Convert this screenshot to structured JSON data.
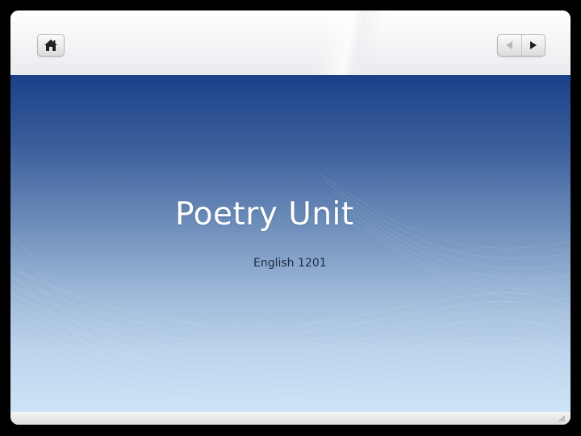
{
  "slide": {
    "title": "Poetry Unit",
    "subtitle": "English 1201"
  },
  "toolbar": {
    "home_icon": "home-icon",
    "prev_icon": "triangle-left-icon",
    "next_icon": "triangle-right-icon"
  },
  "colors": {
    "background": "#000000",
    "frame": "#ffffff",
    "gradient_top": "#1a4089",
    "gradient_bottom": "#cde3f7",
    "title_text": "#ffffff",
    "subtitle_text": "#1f2b3d"
  }
}
